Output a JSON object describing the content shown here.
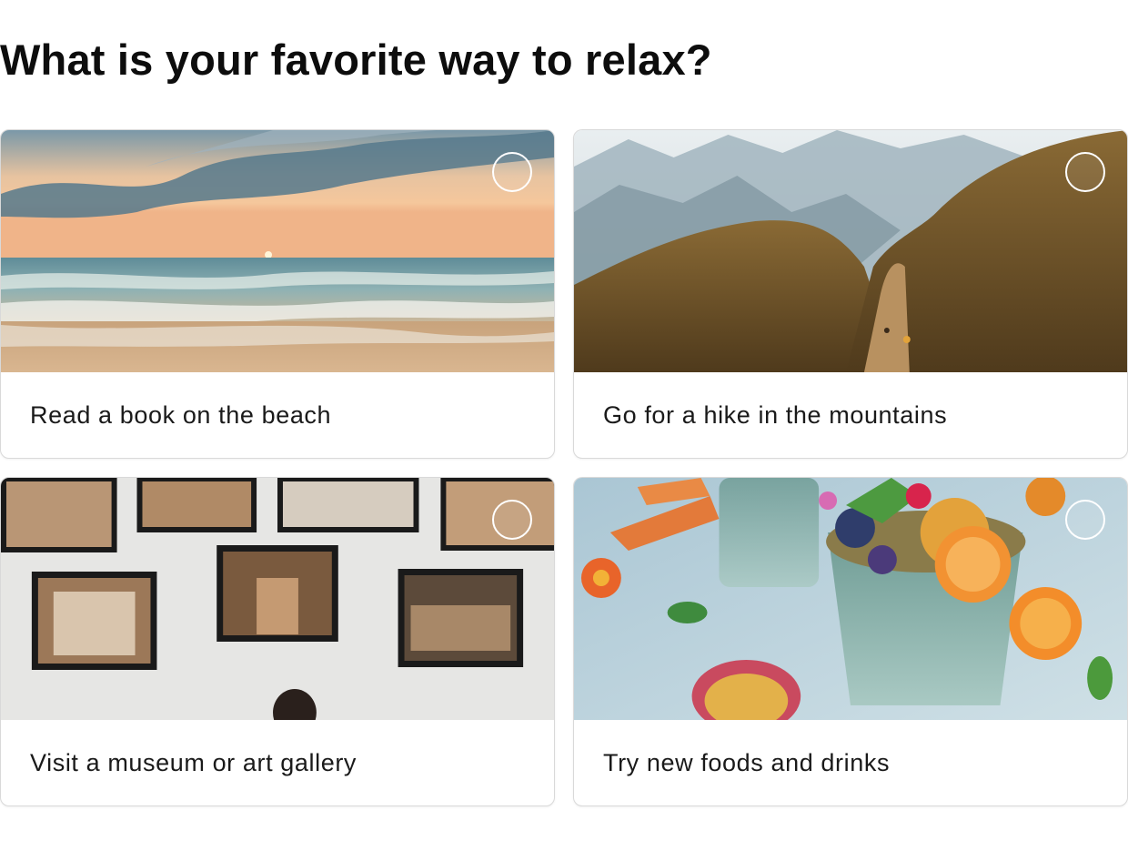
{
  "question": "What is your favorite way to relax?",
  "options": [
    {
      "label": "Read a book on the beach",
      "image": "beach-sunset-photo",
      "selected": false
    },
    {
      "label": "Go for a hike in the mountains",
      "image": "mountain-trail-photo",
      "selected": false
    },
    {
      "label": "Visit a museum or art gallery",
      "image": "gallery-wall-photo",
      "selected": false
    },
    {
      "label": "Try new foods and drinks",
      "image": "fruit-smoothie-photo",
      "selected": false
    }
  ]
}
